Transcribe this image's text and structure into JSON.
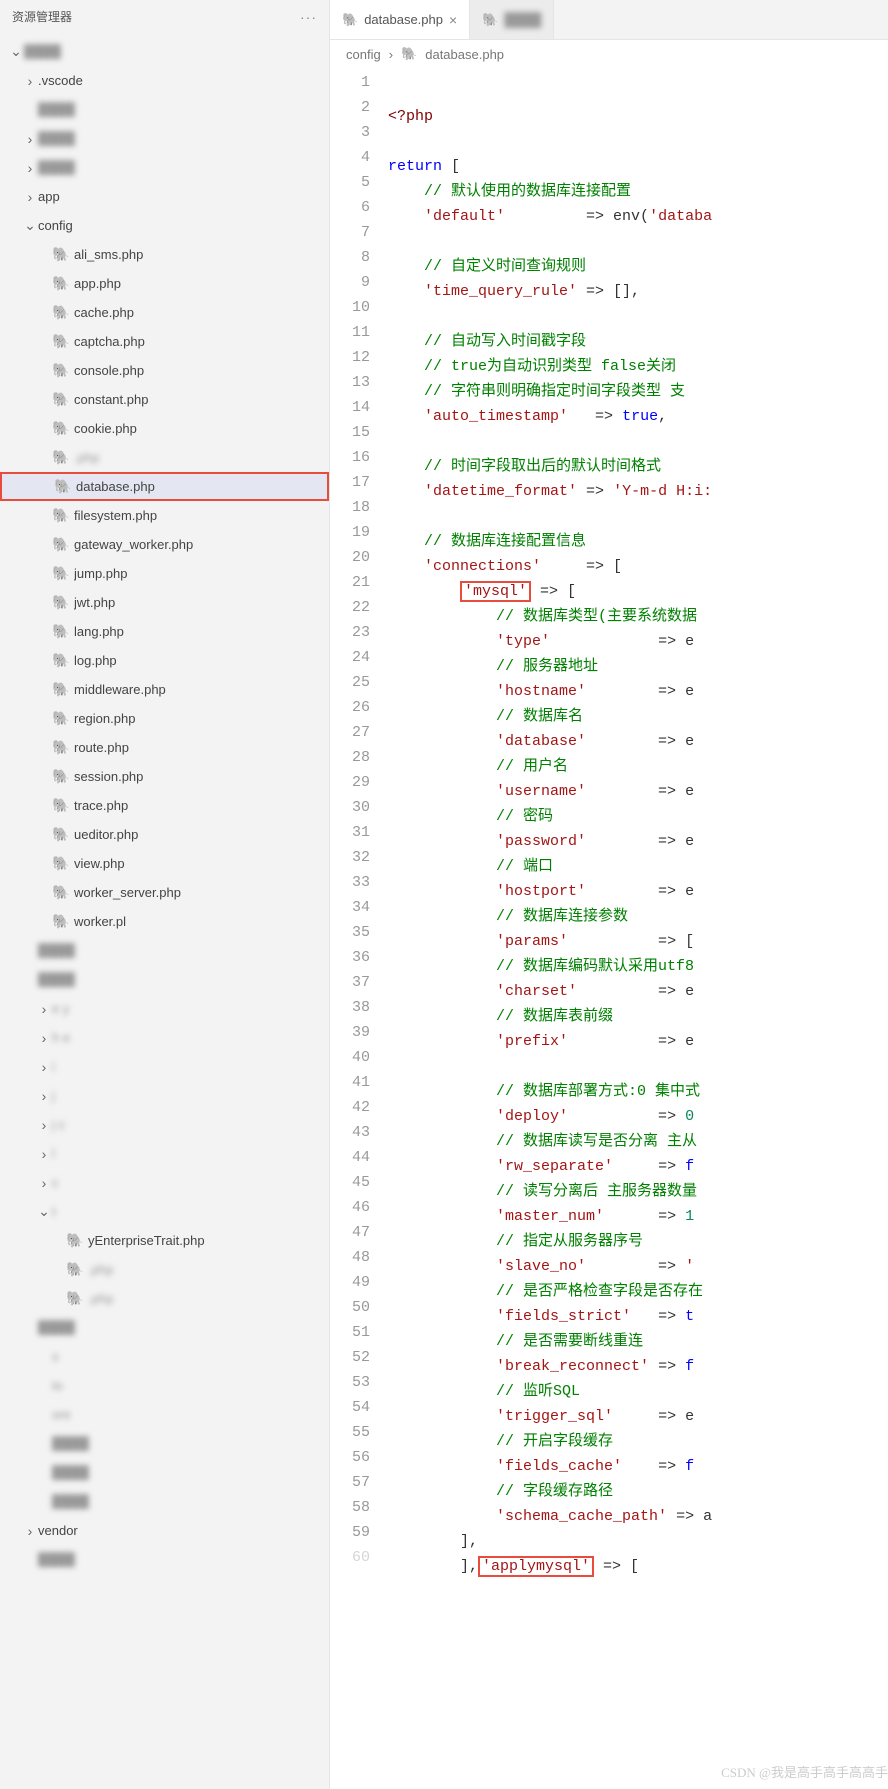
{
  "sidebar": {
    "title": "资源管理器",
    "dots": "···",
    "tree": [
      {
        "chev": "down",
        "depth": 0,
        "icon": "",
        "label": "",
        "blur": true
      },
      {
        "chev": "right",
        "depth": 1,
        "icon": "",
        "label": ".vscode"
      },
      {
        "chev": "none",
        "depth": 1,
        "icon": "",
        "label": "",
        "blur": true
      },
      {
        "chev": "right",
        "depth": 1,
        "icon": "",
        "label": "",
        "blur": true
      },
      {
        "chev": "right",
        "depth": 1,
        "icon": "",
        "label": "",
        "blur": true
      },
      {
        "chev": "right",
        "depth": 1,
        "icon": "",
        "label": "app"
      },
      {
        "chev": "down",
        "depth": 1,
        "icon": "",
        "label": "config"
      },
      {
        "chev": "none",
        "depth": 2,
        "icon": "php",
        "label": "ali_sms.php"
      },
      {
        "chev": "none",
        "depth": 2,
        "icon": "php",
        "label": "app.php"
      },
      {
        "chev": "none",
        "depth": 2,
        "icon": "php",
        "label": "cache.php"
      },
      {
        "chev": "none",
        "depth": 2,
        "icon": "php",
        "label": "captcha.php"
      },
      {
        "chev": "none",
        "depth": 2,
        "icon": "php",
        "label": "console.php"
      },
      {
        "chev": "none",
        "depth": 2,
        "icon": "php",
        "label": "constant.php"
      },
      {
        "chev": "none",
        "depth": 2,
        "icon": "php",
        "label": "cookie.php"
      },
      {
        "chev": "none",
        "depth": 2,
        "icon": "php",
        "label": "                    .php",
        "blur": true
      },
      {
        "chev": "none",
        "depth": 2,
        "icon": "php",
        "label": "database.php",
        "selected": true,
        "redbox": true
      },
      {
        "chev": "none",
        "depth": 2,
        "icon": "php",
        "label": "filesystem.php"
      },
      {
        "chev": "none",
        "depth": 2,
        "icon": "php",
        "label": "gateway_worker.php"
      },
      {
        "chev": "none",
        "depth": 2,
        "icon": "php",
        "label": "jump.php"
      },
      {
        "chev": "none",
        "depth": 2,
        "icon": "php",
        "label": "jwt.php"
      },
      {
        "chev": "none",
        "depth": 2,
        "icon": "php",
        "label": "lang.php"
      },
      {
        "chev": "none",
        "depth": 2,
        "icon": "php",
        "label": "log.php"
      },
      {
        "chev": "none",
        "depth": 2,
        "icon": "php",
        "label": "middleware.php"
      },
      {
        "chev": "none",
        "depth": 2,
        "icon": "php",
        "label": "region.php"
      },
      {
        "chev": "none",
        "depth": 2,
        "icon": "php",
        "label": "route.php"
      },
      {
        "chev": "none",
        "depth": 2,
        "icon": "php",
        "label": "session.php"
      },
      {
        "chev": "none",
        "depth": 2,
        "icon": "php",
        "label": "trace.php"
      },
      {
        "chev": "none",
        "depth": 2,
        "icon": "php",
        "label": "ueditor.php"
      },
      {
        "chev": "none",
        "depth": 2,
        "icon": "php",
        "label": "view.php"
      },
      {
        "chev": "none",
        "depth": 2,
        "icon": "php",
        "label": "worker_server.php"
      },
      {
        "chev": "none",
        "depth": 2,
        "icon": "php",
        "label": "worker.pl",
        "blur": false
      },
      {
        "chev": "none",
        "depth": 1,
        "icon": "",
        "label": "",
        "blur": true
      },
      {
        "chev": "none",
        "depth": 1,
        "icon": "",
        "label": "",
        "blur": true
      },
      {
        "chev": "right",
        "depth": 2,
        "icon": "",
        "label": "e   y",
        "blur": true
      },
      {
        "chev": "right",
        "depth": 2,
        "icon": "",
        "label": "h    e",
        "blur": true
      },
      {
        "chev": "right",
        "depth": 2,
        "icon": "",
        "label": "i",
        "blur": true
      },
      {
        "chev": "right",
        "depth": 2,
        "icon": "",
        "label": "j",
        "blur": true
      },
      {
        "chev": "right",
        "depth": 2,
        "icon": "",
        "label": "j   c",
        "blur": true
      },
      {
        "chev": "right",
        "depth": 2,
        "icon": "",
        "label": "l",
        "blur": true
      },
      {
        "chev": "right",
        "depth": 2,
        "icon": "",
        "label": "c",
        "blur": true
      },
      {
        "chev": "down",
        "depth": 2,
        "icon": "",
        "label": "t",
        "blur": true
      },
      {
        "chev": "none",
        "depth": 3,
        "icon": "php",
        "label": "      yEnterpriseTrait.php",
        "blur": false
      },
      {
        "chev": "none",
        "depth": 3,
        "icon": "php",
        "label": "      .php",
        "blur": true
      },
      {
        "chev": "none",
        "depth": 3,
        "icon": "php",
        "label": "        .php",
        "blur": true
      },
      {
        "chev": "none",
        "depth": 1,
        "icon": "",
        "label": "",
        "blur": true
      },
      {
        "chev": "none",
        "depth": 2,
        "icon": "",
        "label": "      s",
        "blur": true
      },
      {
        "chev": "none",
        "depth": 2,
        "icon": "",
        "label": "      to",
        "blur": true
      },
      {
        "chev": "none",
        "depth": 2,
        "icon": "",
        "label": "      ore",
        "blur": true
      },
      {
        "chev": "none",
        "depth": 2,
        "icon": "",
        "label": "",
        "blur": true
      },
      {
        "chev": "none",
        "depth": 2,
        "icon": "",
        "label": "",
        "blur": true
      },
      {
        "chev": "none",
        "depth": 2,
        "icon": "",
        "label": "",
        "blur": true
      },
      {
        "chev": "right",
        "depth": 1,
        "icon": "",
        "label": "vendor",
        "blur": false
      },
      {
        "chev": "none",
        "depth": 1,
        "icon": "",
        "label": "",
        "blur": true
      }
    ]
  },
  "tabs": [
    {
      "icon": "php",
      "label": "database.php",
      "active": true,
      "close": "×"
    },
    {
      "icon": "php",
      "label": "",
      "active": false,
      "blur": true
    }
  ],
  "breadcrumb": {
    "parts": [
      "config",
      "database.php"
    ],
    "sep": "›"
  },
  "code": {
    "start": 1,
    "lines": [
      [
        {
          "t": "<?php",
          "c": "tag"
        }
      ],
      [],
      [
        {
          "t": "return",
          "c": "kw"
        },
        {
          "t": " ["
        }
      ],
      [
        {
          "t": "    "
        },
        {
          "t": "// 默认使用的数据库连接配置",
          "c": "com"
        }
      ],
      [
        {
          "t": "    "
        },
        {
          "t": "'default'",
          "c": "str"
        },
        {
          "t": "         => env("
        },
        {
          "t": "'databa",
          "c": "str"
        }
      ],
      [],
      [
        {
          "t": "    "
        },
        {
          "t": "// 自定义时间查询规则",
          "c": "com"
        }
      ],
      [
        {
          "t": "    "
        },
        {
          "t": "'time_query_rule'",
          "c": "str"
        },
        {
          "t": " => [],"
        }
      ],
      [],
      [
        {
          "t": "    "
        },
        {
          "t": "// 自动写入时间戳字段",
          "c": "com"
        }
      ],
      [
        {
          "t": "    "
        },
        {
          "t": "// true为自动识别类型 false关闭",
          "c": "com"
        }
      ],
      [
        {
          "t": "    "
        },
        {
          "t": "// 字符串则明确指定时间字段类型 支",
          "c": "com"
        }
      ],
      [
        {
          "t": "    "
        },
        {
          "t": "'auto_timestamp'",
          "c": "str"
        },
        {
          "t": "   => "
        },
        {
          "t": "true",
          "c": "bool"
        },
        {
          "t": ","
        }
      ],
      [],
      [
        {
          "t": "    "
        },
        {
          "t": "// 时间字段取出后的默认时间格式",
          "c": "com"
        }
      ],
      [
        {
          "t": "    "
        },
        {
          "t": "'datetime_format'",
          "c": "str"
        },
        {
          "t": " => "
        },
        {
          "t": "'Y-m-d H:i:",
          "c": "str"
        }
      ],
      [],
      [
        {
          "t": "    "
        },
        {
          "t": "// 数据库连接配置信息",
          "c": "com"
        }
      ],
      [
        {
          "t": "    "
        },
        {
          "t": "'connections'",
          "c": "str"
        },
        {
          "t": "     => ["
        }
      ],
      [
        {
          "t": "        "
        },
        {
          "t": "'mysql'",
          "c": "str",
          "red": true
        },
        {
          "t": " => ["
        }
      ],
      [
        {
          "t": "            "
        },
        {
          "t": "// 数据库类型(主要系统数据",
          "c": "com"
        }
      ],
      [
        {
          "t": "            "
        },
        {
          "t": "'type'",
          "c": "str"
        },
        {
          "t": "            => e"
        }
      ],
      [
        {
          "t": "            "
        },
        {
          "t": "// 服务器地址",
          "c": "com"
        }
      ],
      [
        {
          "t": "            "
        },
        {
          "t": "'hostname'",
          "c": "str"
        },
        {
          "t": "        => e"
        }
      ],
      [
        {
          "t": "            "
        },
        {
          "t": "// 数据库名",
          "c": "com"
        }
      ],
      [
        {
          "t": "            "
        },
        {
          "t": "'database'",
          "c": "str"
        },
        {
          "t": "        => e"
        }
      ],
      [
        {
          "t": "            "
        },
        {
          "t": "// 用户名",
          "c": "com"
        }
      ],
      [
        {
          "t": "            "
        },
        {
          "t": "'username'",
          "c": "str"
        },
        {
          "t": "        => e"
        }
      ],
      [
        {
          "t": "            "
        },
        {
          "t": "// 密码",
          "c": "com"
        }
      ],
      [
        {
          "t": "            "
        },
        {
          "t": "'password'",
          "c": "str"
        },
        {
          "t": "        => e"
        }
      ],
      [
        {
          "t": "            "
        },
        {
          "t": "// 端口",
          "c": "com"
        }
      ],
      [
        {
          "t": "            "
        },
        {
          "t": "'hostport'",
          "c": "str"
        },
        {
          "t": "        => e"
        }
      ],
      [
        {
          "t": "            "
        },
        {
          "t": "// 数据库连接参数",
          "c": "com"
        }
      ],
      [
        {
          "t": "            "
        },
        {
          "t": "'params'",
          "c": "str"
        },
        {
          "t": "          => ["
        }
      ],
      [
        {
          "t": "            "
        },
        {
          "t": "// 数据库编码默认采用utf8",
          "c": "com"
        }
      ],
      [
        {
          "t": "            "
        },
        {
          "t": "'charset'",
          "c": "str"
        },
        {
          "t": "         => e"
        }
      ],
      [
        {
          "t": "            "
        },
        {
          "t": "// 数据库表前缀",
          "c": "com"
        }
      ],
      [
        {
          "t": "            "
        },
        {
          "t": "'prefix'",
          "c": "str"
        },
        {
          "t": "          => e"
        }
      ],
      [],
      [
        {
          "t": "            "
        },
        {
          "t": "// 数据库部署方式:0 集中式",
          "c": "com"
        }
      ],
      [
        {
          "t": "            "
        },
        {
          "t": "'deploy'",
          "c": "str"
        },
        {
          "t": "          => "
        },
        {
          "t": "0",
          "c": "num"
        }
      ],
      [
        {
          "t": "            "
        },
        {
          "t": "// 数据库读写是否分离 主从",
          "c": "com"
        }
      ],
      [
        {
          "t": "            "
        },
        {
          "t": "'rw_separate'",
          "c": "str"
        },
        {
          "t": "     => "
        },
        {
          "t": "f",
          "c": "bool"
        }
      ],
      [
        {
          "t": "            "
        },
        {
          "t": "// 读写分离后 主服务器数量",
          "c": "com"
        }
      ],
      [
        {
          "t": "            "
        },
        {
          "t": "'master_num'",
          "c": "str"
        },
        {
          "t": "      => "
        },
        {
          "t": "1",
          "c": "num"
        }
      ],
      [
        {
          "t": "            "
        },
        {
          "t": "// 指定从服务器序号",
          "c": "com"
        }
      ],
      [
        {
          "t": "            "
        },
        {
          "t": "'slave_no'",
          "c": "str"
        },
        {
          "t": "        => "
        },
        {
          "t": "'",
          "c": "str"
        }
      ],
      [
        {
          "t": "            "
        },
        {
          "t": "// 是否严格检查字段是否存在",
          "c": "com"
        }
      ],
      [
        {
          "t": "            "
        },
        {
          "t": "'fields_strict'",
          "c": "str"
        },
        {
          "t": "   => "
        },
        {
          "t": "t",
          "c": "bool"
        }
      ],
      [
        {
          "t": "            "
        },
        {
          "t": "// 是否需要断线重连",
          "c": "com"
        }
      ],
      [
        {
          "t": "            "
        },
        {
          "t": "'break_reconnect'",
          "c": "str"
        },
        {
          "t": " => "
        },
        {
          "t": "f",
          "c": "bool"
        }
      ],
      [
        {
          "t": "            "
        },
        {
          "t": "// 监听SQL",
          "c": "com"
        }
      ],
      [
        {
          "t": "            "
        },
        {
          "t": "'trigger_sql'",
          "c": "str"
        },
        {
          "t": "     => e"
        }
      ],
      [
        {
          "t": "            "
        },
        {
          "t": "// 开启字段缓存",
          "c": "com"
        }
      ],
      [
        {
          "t": "            "
        },
        {
          "t": "'fields_cache'",
          "c": "str"
        },
        {
          "t": "    => "
        },
        {
          "t": "f",
          "c": "bool"
        }
      ],
      [
        {
          "t": "            "
        },
        {
          "t": "// 字段缓存路径",
          "c": "com"
        }
      ],
      [
        {
          "t": "            "
        },
        {
          "t": "'schema_cache_path'",
          "c": "str"
        },
        {
          "t": " => a"
        }
      ],
      [
        {
          "t": "        ],"
        }
      ],
      [
        {
          "t": "        ],"
        },
        {
          "t": "'applymysql'",
          "c": "str",
          "red": true
        },
        {
          "t": " => ["
        }
      ]
    ]
  },
  "watermark": "CSDN @我是高手高手高高手"
}
